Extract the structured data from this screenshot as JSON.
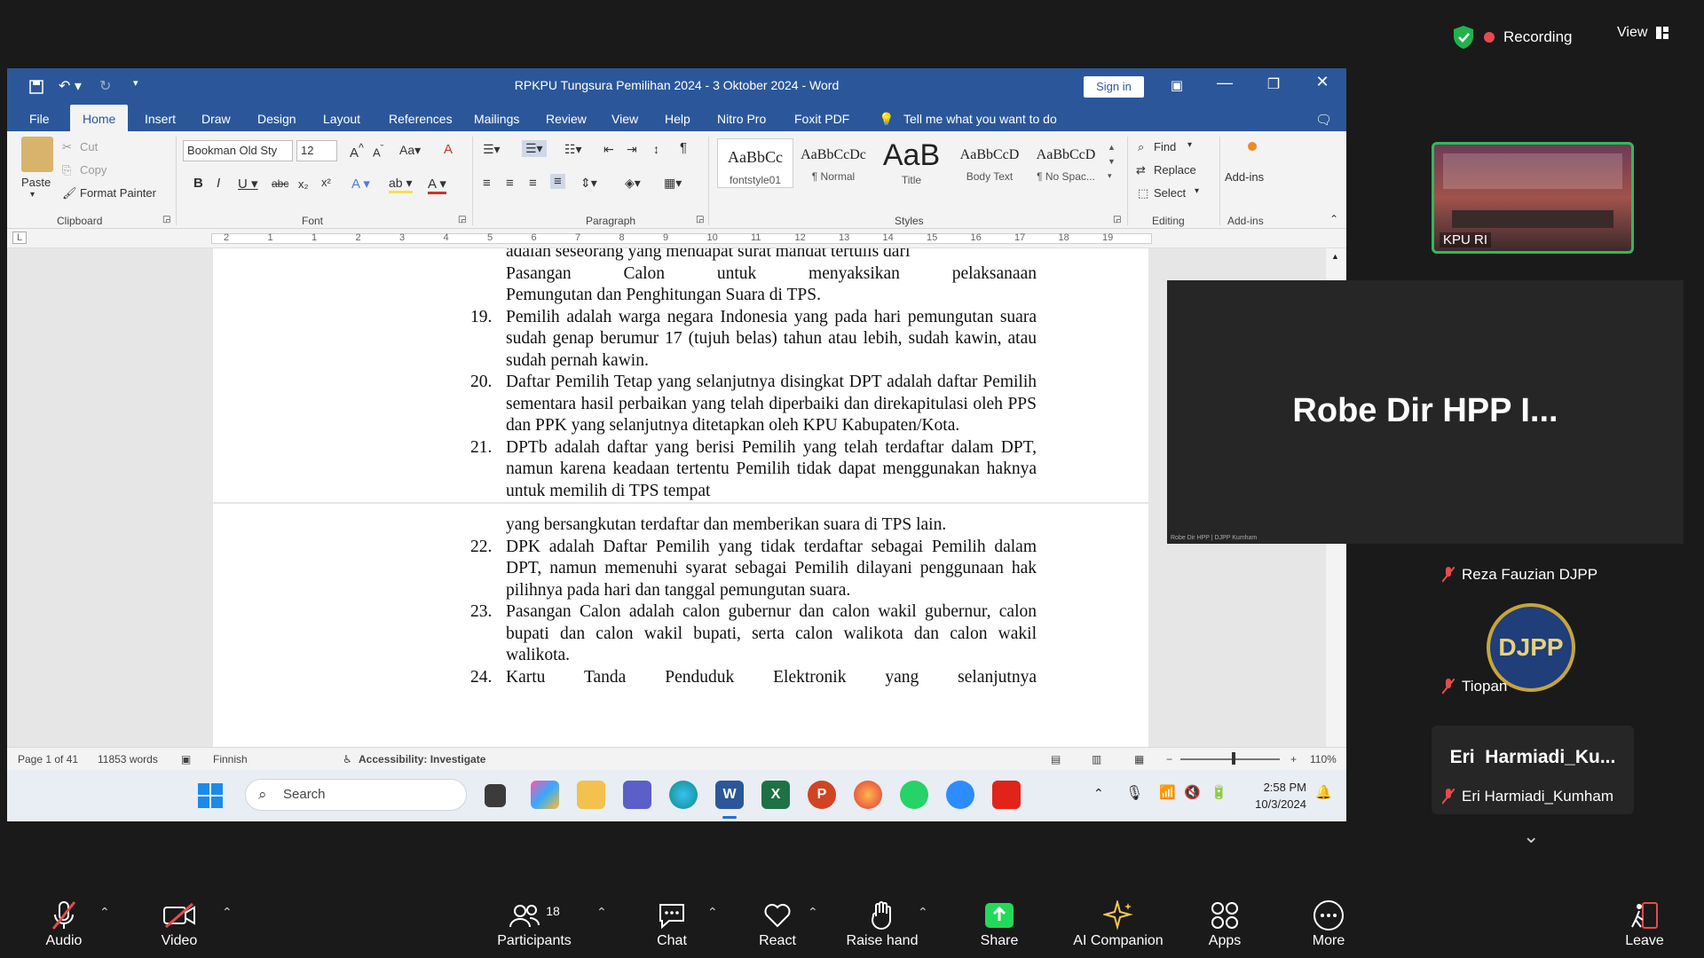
{
  "zoom": {
    "recording_label": "Recording",
    "view_label": "View",
    "speaker_name": "Robe Dir HPP I...",
    "speaker_small_label": "Robe Dir HPP | DJPP Kumham",
    "kpu_label": "KPU RI",
    "participants": [
      {
        "name": "Reza Fauzian DJPP",
        "muted": true
      },
      {
        "name": "Tiopan",
        "muted": true,
        "avatar_text": "DJPP"
      },
      {
        "name": "Eri  Harmiadi_Ku...",
        "display_big": true
      },
      {
        "name": "Eri Harmiadi_Kumham",
        "muted": true
      }
    ],
    "toolbar": {
      "audio": "Audio",
      "video": "Video",
      "participants": "Participants",
      "participants_count": "18",
      "chat": "Chat",
      "react": "React",
      "raise_hand": "Raise hand",
      "share": "Share",
      "ai_companion": "AI Companion",
      "apps": "Apps",
      "more": "More",
      "leave": "Leave"
    },
    "colors": {
      "share": "#23d959",
      "recording_dot": "#e84b4b",
      "active_border": "#2fb95f",
      "leave": "#e84b4b"
    }
  },
  "word": {
    "title": "RPKPU Tungsura Pemilihan 2024 - 3 Oktober 2024  -  Word",
    "sign_in": "Sign in",
    "tabs": [
      "File",
      "Home",
      "Insert",
      "Draw",
      "Design",
      "Layout",
      "References",
      "Mailings",
      "Review",
      "View",
      "Help",
      "Nitro Pro",
      "Foxit PDF"
    ],
    "active_tab": "Home",
    "tell_me": "Tell me what you want to do",
    "clipboard": {
      "paste": "Paste",
      "cut": "Cut",
      "copy": "Copy",
      "format_painter": "Format Painter",
      "group": "Clipboard"
    },
    "font": {
      "name": "Bookman Old Sty",
      "size": "12",
      "group": "Font"
    },
    "paragraph_group": "Paragraph",
    "styles": {
      "group": "Styles",
      "items": [
        {
          "preview": "AaBbCc",
          "label": "fontstyle01"
        },
        {
          "preview": "AaBbCcDc",
          "label": "¶ Normal"
        },
        {
          "preview": "AaB",
          "label": "Title"
        },
        {
          "preview": "AaBbCcD",
          "label": "Body Text"
        },
        {
          "preview": "AaBbCcD",
          "label": "¶ No Spac..."
        }
      ]
    },
    "editing": {
      "find": "Find",
      "replace": "Replace",
      "select": "Select",
      "group": "Editing"
    },
    "addins": {
      "label": "Add-ins",
      "group": "Add-ins"
    },
    "ruler_numbers": [
      "2",
      "1",
      "1",
      "2",
      "3",
      "4",
      "5",
      "6",
      "7",
      "8",
      "9",
      "10",
      "11",
      "12",
      "13",
      "14",
      "15",
      "16",
      "17",
      "18",
      "19"
    ],
    "document": {
      "page1_top_lines": [
        "adalah seseorang yang mendapat surat mandat tertulis dari",
        "Pasangan Calon untuk menyaksikan pelaksanaan",
        "Pemungutan dan Penghitungan Suara di TPS."
      ],
      "page1_items": [
        {
          "num": "19.",
          "text": "Pemilih adalah warga negara Indonesia yang pada hari pemungutan suara sudah genap berumur 17 (tujuh belas) tahun atau lebih, sudah kawin, atau sudah pernah kawin."
        },
        {
          "num": "20.",
          "text": "Daftar Pemilih Tetap yang selanjutnya disingkat DPT adalah daftar Pemilih sementara hasil perbaikan yang telah diperbaiki dan direkapitulasi oleh PPS dan PPK yang selanjutnya ditetapkan oleh KPU Kabupaten/Kota."
        },
        {
          "num": "21.",
          "text": "DPTb adalah daftar yang berisi Pemilih yang telah terdaftar dalam DPT, namun karena keadaan tertentu Pemilih tidak dapat menggunakan haknya untuk memilih di TPS tempat"
        }
      ],
      "page2_continuation": "yang bersangkutan terdaftar dan memberikan suara di TPS lain.",
      "page2_items": [
        {
          "num": "22.",
          "text": "DPK adalah Daftar Pemilih yang tidak terdaftar sebagai Pemilih dalam DPT, namun memenuhi syarat sebagai Pemilih dilayani penggunaan hak pilihnya pada hari dan tanggal pemungutan suara."
        },
        {
          "num": "23.",
          "text": "Pasangan Calon adalah calon gubernur dan calon wakil gubernur, calon bupati dan calon wakil bupati, serta calon walikota dan calon wakil walikota."
        },
        {
          "num": "24.",
          "text": "Kartu Tanda Penduduk Elektronik yang selanjutnya"
        }
      ]
    },
    "status": {
      "page": "Page 1 of 41",
      "words": "11853 words",
      "language": "Finnish",
      "accessibility": "Accessibility: Investigate",
      "zoom": "110%"
    }
  },
  "taskbar": {
    "search": "Search",
    "time": "2:58 PM",
    "date": "10/3/2024"
  }
}
